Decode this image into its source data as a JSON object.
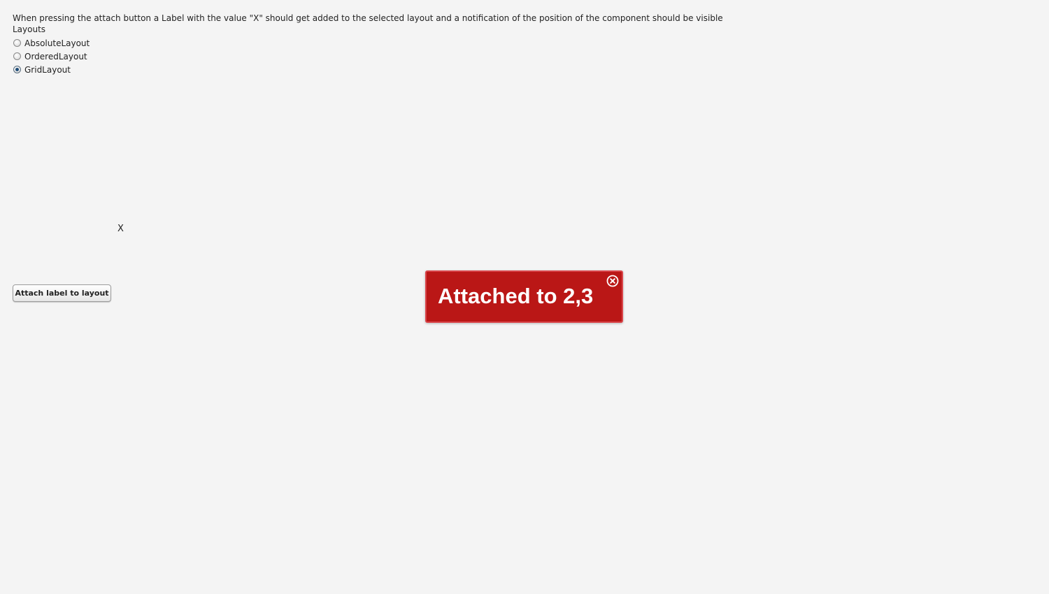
{
  "description": "When pressing the attach button a Label with the value \"X\" should get added to the selected layout and a notification of the position of the component should be visible",
  "layouts": {
    "caption": "Layouts",
    "options": [
      {
        "label": "AbsoluteLayout",
        "checked": false
      },
      {
        "label": "OrderedLayout",
        "checked": false
      },
      {
        "label": "GridLayout",
        "checked": true
      }
    ]
  },
  "attached_label": {
    "value": "X"
  },
  "attach_button": {
    "label": "Attach label to layout"
  },
  "notification": {
    "message": "Attached to 2,3",
    "close_icon": "close-circle-icon",
    "background_color": "#ba1716"
  }
}
